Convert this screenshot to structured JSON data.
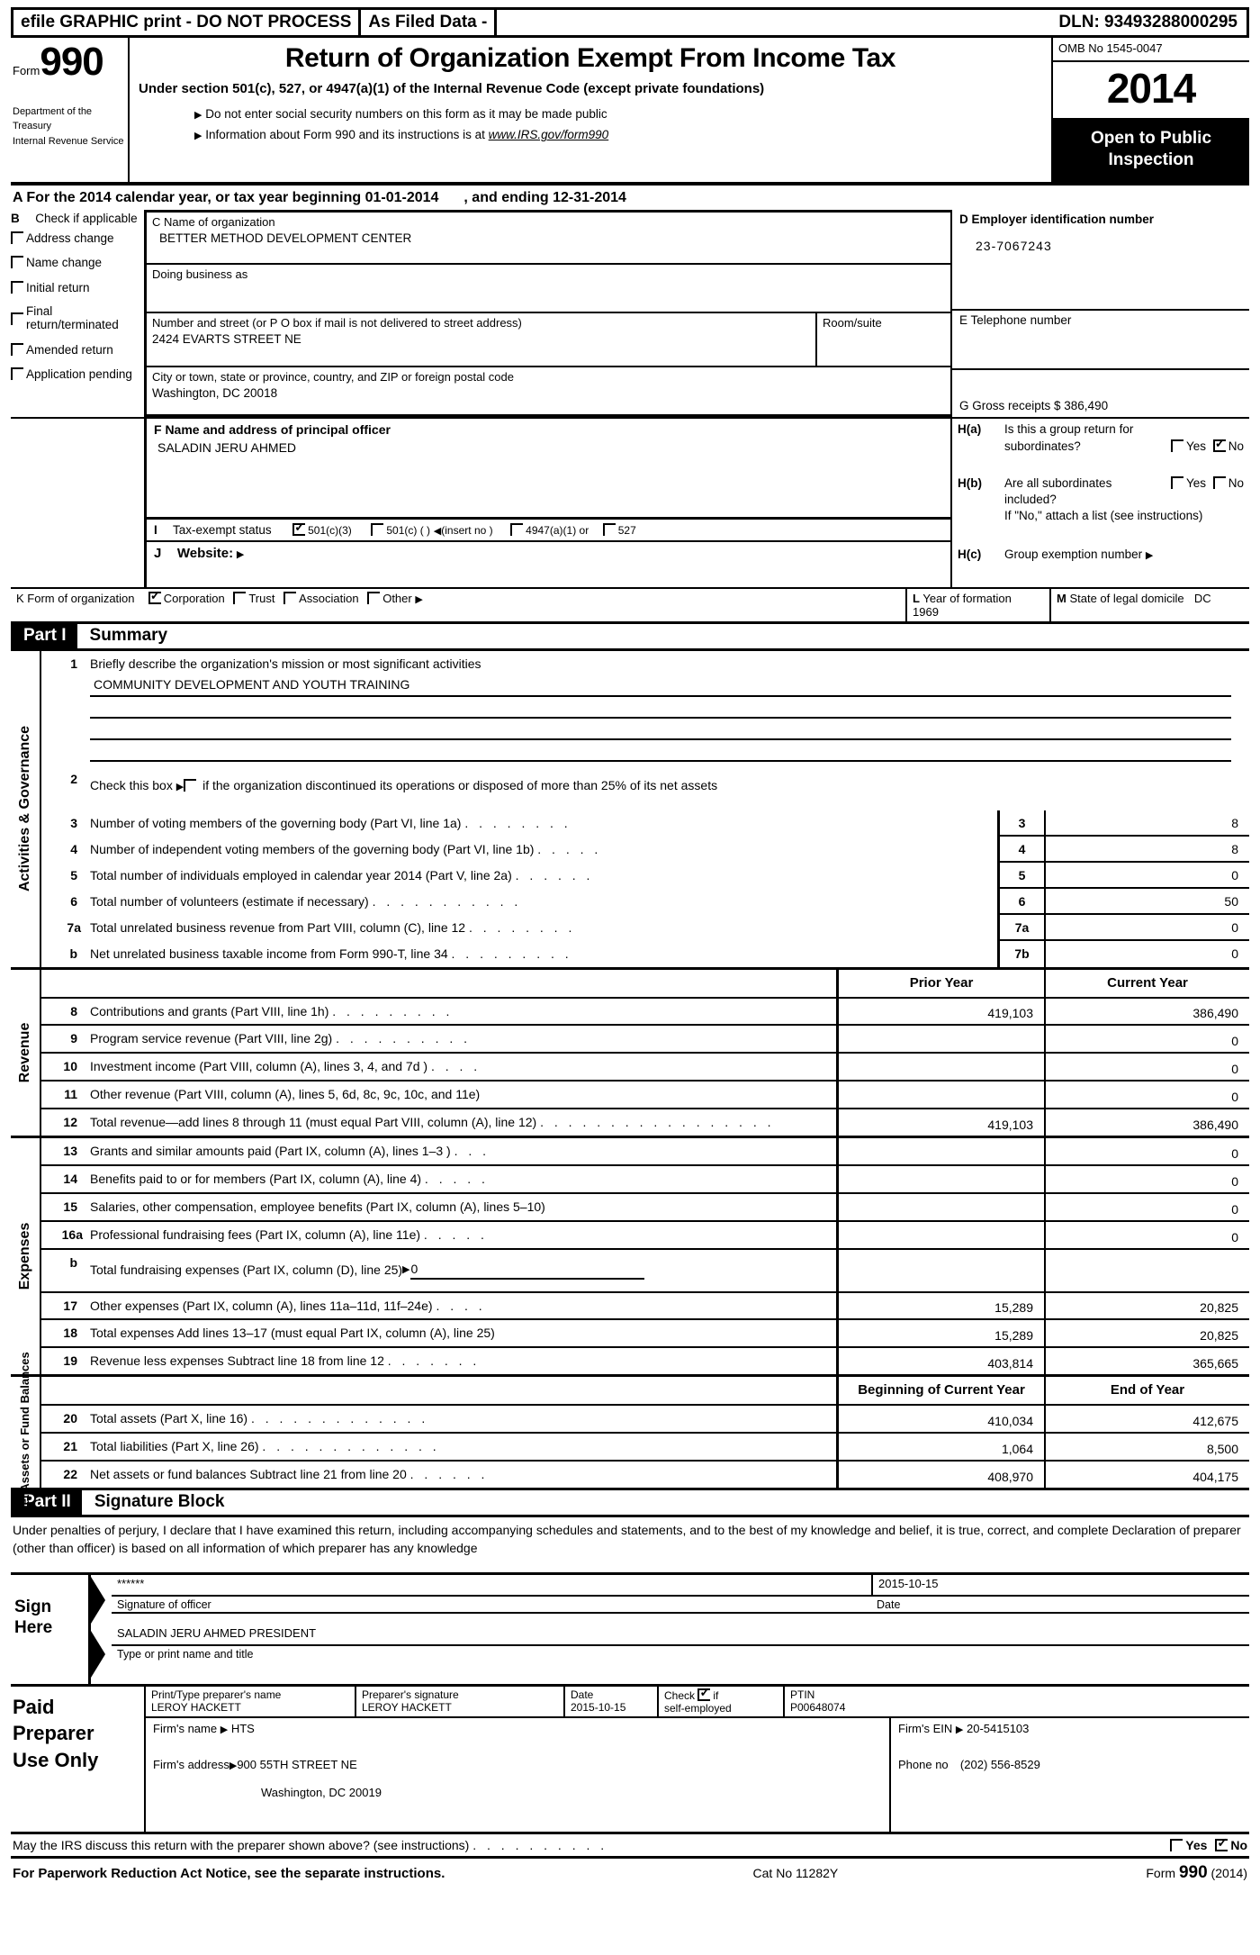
{
  "banner": {
    "efile": "efile GRAPHIC print - DO NOT PROCESS",
    "as_filed": "As Filed Data -",
    "dln": "DLN: 93493288000295"
  },
  "masthead": {
    "form_label": "Form",
    "form_number": "990",
    "dept_line1": "Department of the Treasury",
    "dept_line2": "Internal Revenue Service",
    "title": "Return of Organization Exempt From Income Tax",
    "subtitle": "Under section 501(c), 527, or 4947(a)(1) of the Internal Revenue Code (except private foundations)",
    "bullet1": "Do not enter social security numbers on this form as it may be made public",
    "bullet2_pre": "Information about Form 990 and its instructions is at ",
    "bullet2_link": "www.IRS.gov/form990",
    "omb": "OMB No 1545-0047",
    "tax_year": "2014",
    "open_public_line1": "Open to Public",
    "open_public_line2": "Inspection"
  },
  "section_a": {
    "text_pre": "A  For the 2014 calendar year, or tax year beginning ",
    "begin_date": "01-01-2014",
    "text_mid": ", and ending ",
    "end_date": "12-31-2014"
  },
  "section_b": {
    "key": "B",
    "heading": "Check if applicable",
    "options": [
      {
        "label": "Address change",
        "checked": false
      },
      {
        "label": "Name change",
        "checked": false
      },
      {
        "label": "Initial return",
        "checked": false
      },
      {
        "label": "Final return/terminated",
        "checked": false
      },
      {
        "label": "Amended return",
        "checked": false
      },
      {
        "label": "Application pending",
        "checked": false
      }
    ]
  },
  "section_c": {
    "name_label": "C Name of organization",
    "name_value": "BETTER METHOD DEVELOPMENT CENTER",
    "dba_label": "Doing business as",
    "dba_value": "",
    "street_label": "Number and street (or P O  box if mail is not delivered to street address)",
    "street_value": "2424 EVARTS STREET NE",
    "room_label": "Room/suite",
    "room_value": "",
    "city_label": "City or town, state or province, country, and ZIP or foreign postal code",
    "city_value": "Washington, DC  20018"
  },
  "section_d": {
    "ein_label": "D Employer identification number",
    "ein_value": "23-7067243",
    "phone_label": "E Telephone number",
    "phone_value": "",
    "gross_receipts_label": "G Gross receipts $ 386,490"
  },
  "section_f": {
    "label": "F   Name and address of principal officer",
    "value": "SALADIN JERU AHMED"
  },
  "section_i": {
    "key": "I",
    "label": "Tax-exempt status",
    "options": [
      {
        "label": "501(c)(3)",
        "checked": true
      },
      {
        "label": "501(c) (   )",
        "checked": false
      },
      {
        "label": "4947(a)(1) or",
        "checked": false
      },
      {
        "label": "527",
        "checked": false
      }
    ],
    "insert_note": "(insert no )"
  },
  "section_j": {
    "key": "J",
    "label": "Website:",
    "value": ""
  },
  "section_h": {
    "ha_key": "H(a)",
    "ha_line1": "Is this a group return for",
    "ha_line2": "subordinates?",
    "ha_yes": "Yes",
    "ha_no": "No",
    "ha_yes_checked": false,
    "ha_no_checked": true,
    "hb_key": "H(b)",
    "hb_line1": "Are all subordinates",
    "hb_line2": "included?",
    "hb_yes": "Yes",
    "hb_no": "No",
    "hb_yes_checked": false,
    "hb_no_checked": false,
    "hb_note": "If \"No,\" attach a list  (see instructions)",
    "hc_key": "H(c)",
    "hc_label": "Group exemption number",
    "hc_value": ""
  },
  "section_k": {
    "label": "K Form of organization",
    "options": [
      {
        "label": "Corporation",
        "checked": true
      },
      {
        "label": "Trust",
        "checked": false
      },
      {
        "label": "Association",
        "checked": false
      },
      {
        "label": "Other",
        "checked": false
      }
    ]
  },
  "section_l": {
    "label": "L Year of formation",
    "value": "1969"
  },
  "section_m": {
    "label": "M State of legal domicile",
    "value": "DC"
  },
  "part1": {
    "tag": "Part I",
    "name": "Summary",
    "sidebar_activities": "Activities & Governance",
    "sidebar_revenue": "Revenue",
    "sidebar_expenses": "Expenses",
    "sidebar_netassets": "Net Assets or Fund Balances",
    "line1_num": "1",
    "line1_label": "Briefly describe the organization's mission or most significant activities",
    "line1_value": "COMMUNITY DEVELOPMENT AND YOUTH TRAINING",
    "line2_num": "2",
    "line2_label_pre": "Check this box",
    "line2_label_post": "if the organization discontinued its operations or disposed of more than 25% of its net assets",
    "line2_checked": false,
    "gov_rows": [
      {
        "num": "3",
        "label": "Number of voting members of the governing body (Part VI, line 1a)",
        "dots": ". . . . . . . .",
        "box": "3",
        "value": "8"
      },
      {
        "num": "4",
        "label": "Number of independent voting members of the governing body (Part VI, line 1b)",
        "dots": ". . . . .",
        "box": "4",
        "value": "8"
      },
      {
        "num": "5",
        "label": "Total number of individuals employed in calendar year 2014 (Part V, line 2a)",
        "dots": ". . . . . .",
        "box": "5",
        "value": "0"
      },
      {
        "num": "6",
        "label": "Total number of volunteers (estimate if necessary)",
        "dots": ". . . . . . . . . . .",
        "box": "6",
        "value": "50"
      },
      {
        "num": "7a",
        "label": "Total unrelated business revenue from Part VIII, column (C), line 12",
        "dots": ". . . . . . . .",
        "box": "7a",
        "value": "0"
      },
      {
        "num": "b",
        "label": "Net unrelated business taxable income from Form 990-T, line 34",
        "dots": ". . . . . . . . .",
        "box": "7b",
        "value": "0"
      }
    ],
    "col_prior": "Prior Year",
    "col_current": "Current Year",
    "revenue_rows": [
      {
        "num": "8",
        "label": "Contributions and grants (Part VIII, line 1h)",
        "dots": ". . . . . . . . .",
        "prior": "419,103",
        "current": "386,490"
      },
      {
        "num": "9",
        "label": "Program service revenue (Part VIII, line 2g)",
        "dots": ". . . . . . . . . .",
        "prior": "",
        "current": "0"
      },
      {
        "num": "10",
        "label": "Investment income (Part VIII, column (A), lines 3, 4, and 7d )",
        "dots": ". . . .",
        "prior": "",
        "current": "0"
      },
      {
        "num": "11",
        "label": "Other revenue (Part VIII, column (A), lines 5, 6d, 8c, 9c, 10c, and 11e)",
        "dots": "",
        "prior": "",
        "current": "0"
      },
      {
        "num": "12",
        "label": "Total revenue—add lines 8 through 11 (must equal Part VIII, column (A), line 12)",
        "dots": ". . . . . . . . . . . . . . . . .",
        "prior": "419,103",
        "current": "386,490"
      }
    ],
    "expense_rows": [
      {
        "num": "13",
        "label": "Grants and similar amounts paid (Part IX, column (A), lines 1–3 )",
        "dots": ". . .",
        "prior": "",
        "current": "0"
      },
      {
        "num": "14",
        "label": "Benefits paid to or for members (Part IX, column (A), line 4)",
        "dots": ". . . . .",
        "prior": "",
        "current": "0"
      },
      {
        "num": "15",
        "label": "Salaries, other compensation, employee benefits (Part IX, column (A), lines 5–10)",
        "dots": "",
        "prior": "",
        "current": "0"
      },
      {
        "num": "16a",
        "label": "Professional fundraising fees (Part IX, column (A), line 11e)",
        "dots": ". . . . .",
        "prior": "",
        "current": "0"
      },
      {
        "num": "17",
        "label": "Other expenses (Part IX, column (A), lines 11a–11d, 11f–24e)",
        "dots": ". . . .",
        "prior": "15,289",
        "current": "20,825"
      },
      {
        "num": "18",
        "label": "Total expenses  Add lines 13–17 (must equal Part IX, column (A), line 25)",
        "dots": "",
        "prior": "15,289",
        "current": "20,825"
      },
      {
        "num": "19",
        "label": "Revenue less expenses  Subtract line 18 from line 12",
        "dots": ". . . . . . .",
        "prior": "403,814",
        "current": "365,665"
      }
    ],
    "line16b_num": "b",
    "line16b_label": "Total fundraising expenses (Part IX, column (D), line 25)",
    "line16b_value": "0",
    "col_begin": "Beginning of Current Year",
    "col_end": "End of Year",
    "netasset_rows": [
      {
        "num": "20",
        "label": "Total assets (Part X, line 16)",
        "dots": ". . . . . . . . . . . . .",
        "prior": "410,034",
        "current": "412,675"
      },
      {
        "num": "21",
        "label": "Total liabilities (Part X, line 26)",
        "dots": ". . . . . . . . . . . . .",
        "prior": "1,064",
        "current": "8,500"
      },
      {
        "num": "22",
        "label": "Net assets or fund balances  Subtract line 21 from line 20",
        "dots": ". . . . . .",
        "prior": "408,970",
        "current": "404,175"
      }
    ]
  },
  "part2": {
    "tag": "Part II",
    "name": "Signature Block",
    "perjury": "Under penalties of perjury, I declare that I have examined this return, including accompanying schedules and statements, and to the best of my knowledge and belief, it is true, correct, and complete  Declaration of preparer (other than officer) is based on all information of which preparer has any knowledge",
    "sign_here_1": "Sign",
    "sign_here_2": "Here",
    "officer_signature_value": "******",
    "officer_signature_label": "Signature of officer",
    "officer_date_value": "2015-10-15",
    "officer_date_label": "Date",
    "officer_name_value": "SALADIN JERU AHMED PRESIDENT",
    "officer_name_label": "Type or print name and title",
    "paid_1": "Paid",
    "paid_2": "Preparer",
    "paid_3": "Use Only",
    "prep_name_label": "Print/Type preparer's name",
    "prep_name_value": "LEROY HACKETT",
    "prep_sig_label": "Preparer's signature",
    "prep_sig_value": "LEROY HACKETT",
    "prep_date_label": "Date",
    "prep_date_value": "2015-10-15",
    "prep_check_label_1": "Check",
    "prep_check_label_2": "if",
    "prep_check_label_3": "self-employed",
    "prep_check_checked": true,
    "ptin_label": "PTIN",
    "ptin_value": "P00648074",
    "firm_name_label": "Firm's name",
    "firm_name_value": "HTS",
    "firm_ein_label": "Firm's EIN",
    "firm_ein_value": "20-5415103",
    "firm_addr_label": "Firm's address",
    "firm_addr_value": "900 55TH STREET NE",
    "firm_addr_value2": "Washington, DC  20019",
    "phone_label": "Phone no",
    "phone_value": "(202) 556-8529",
    "irs_discuss": "May the IRS discuss this return with the preparer shown above? (see instructions)",
    "irs_dots": ". . . . . . . . . .",
    "irs_yes": "Yes",
    "irs_no": "No",
    "irs_yes_checked": false,
    "irs_no_checked": true,
    "paperwork": "For Paperwork Reduction Act Notice, see the separate instructions.",
    "cat_no": "Cat No  11282Y",
    "form_foot_pre": "Form ",
    "form_foot_num": "990",
    "form_foot_year": "(2014)"
  }
}
